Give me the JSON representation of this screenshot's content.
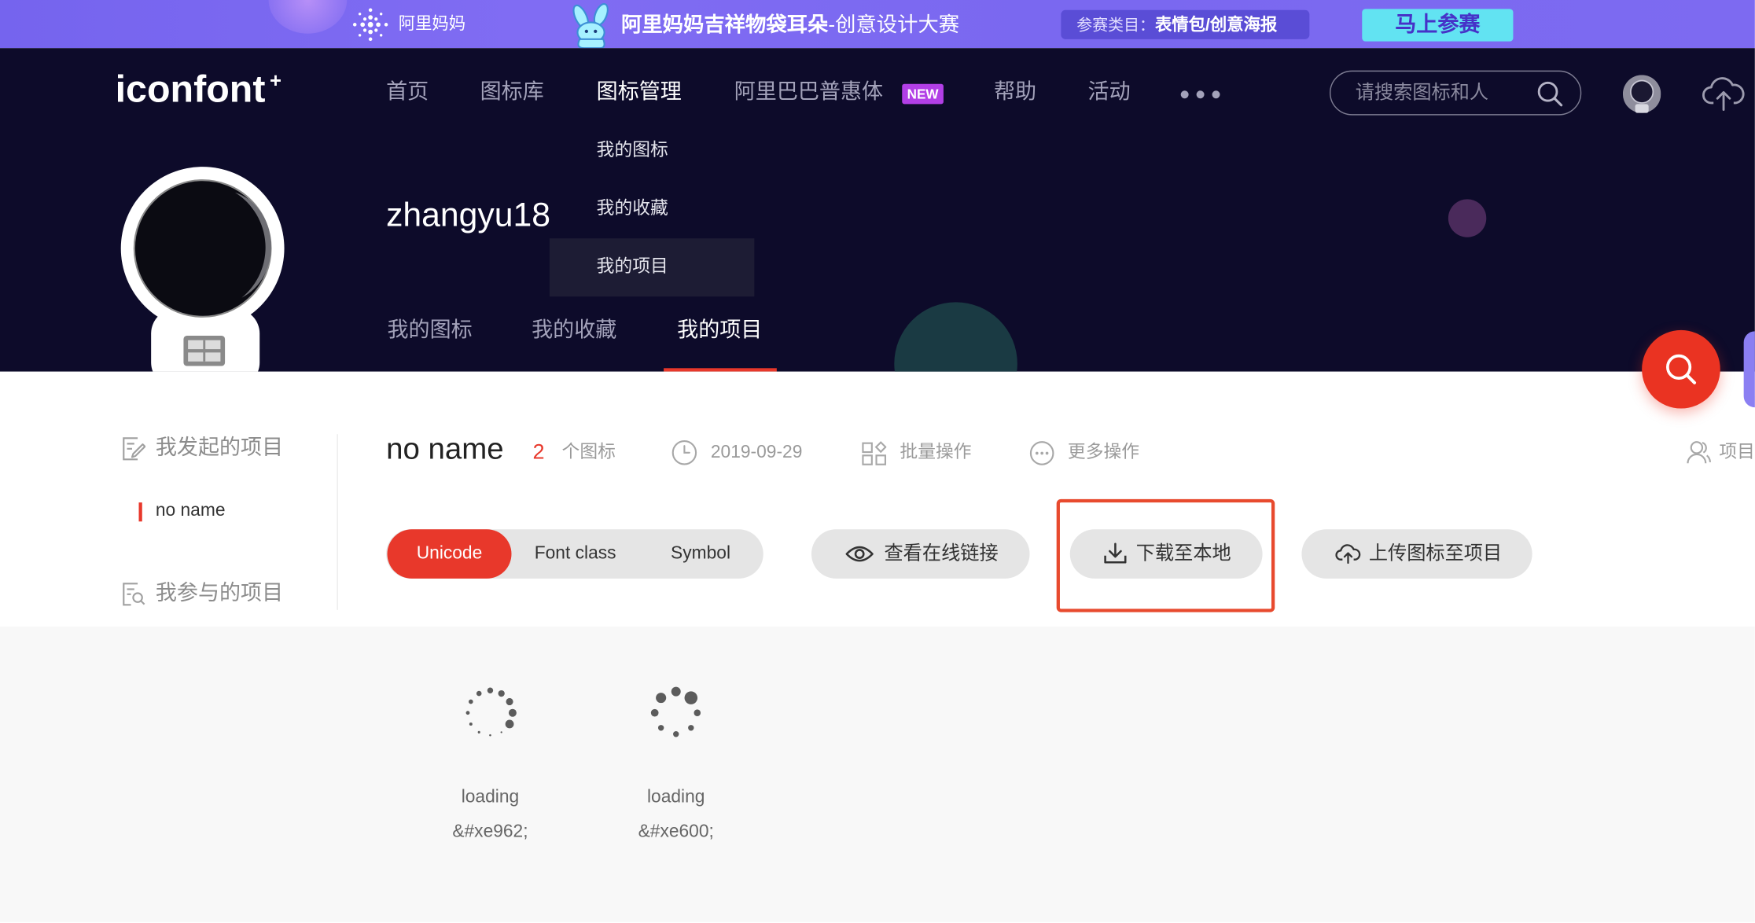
{
  "banner": {
    "brand_name": "阿里妈妈",
    "brand_icon": "alimama-logo-icon",
    "mascot_icon": "kangaroo-mascot-icon",
    "title_bold": "阿里妈妈吉祥物袋耳朵",
    "title_rest": "-创意设计大赛",
    "category_label": "参赛类目：",
    "category_value": "表情包/创意海报",
    "cta_label": "马上参赛",
    "background_color": "#7b68ee",
    "cta_color": "#62e3f2"
  },
  "header": {
    "logo_text": "iconfont",
    "logo_plus": "+",
    "nav": [
      {
        "label": "首页"
      },
      {
        "label": "图标库"
      },
      {
        "label": "图标管理",
        "active": true
      },
      {
        "label": "阿里巴巴普惠体",
        "badge": "NEW"
      },
      {
        "label": "帮助"
      },
      {
        "label": "活动"
      }
    ],
    "more_icon": "ellipsis-icon",
    "search": {
      "placeholder": "请搜索图标和人",
      "icon": "search-icon"
    },
    "user_icon": "avatar-icon",
    "upload_icon": "cloud-upload-icon",
    "background_color": "#0d0b2a"
  },
  "nav_dropdown": {
    "items": [
      {
        "label": "我的图标"
      },
      {
        "label": "我的收藏"
      },
      {
        "label": "我的项目",
        "active": true
      }
    ]
  },
  "profile": {
    "username": "zhangyu18",
    "avatar_icon": "astronaut-avatar-icon",
    "tabs": [
      {
        "label": "我的图标"
      },
      {
        "label": "我的收藏"
      },
      {
        "label": "我的项目",
        "active": true
      }
    ]
  },
  "floating_search": {
    "icon": "search-icon",
    "color": "#ea3322"
  },
  "sidebar": {
    "created_heading": "我发起的项目",
    "created_icon": "document-edit-icon",
    "created_items": [
      {
        "label": "no name",
        "active": true
      }
    ],
    "joined_heading": "我参与的项目",
    "joined_icon": "document-search-icon"
  },
  "project": {
    "name": "no name",
    "icon_count": "2",
    "icon_count_unit": "个图标",
    "date": "2019-09-29",
    "date_icon": "clock-icon",
    "batch_label": "批量操作",
    "batch_icon": "batch-grid-icon",
    "more_label": "更多操作",
    "more_icon": "more-circle-icon",
    "members_label": "项目",
    "members_icon": "members-icon"
  },
  "toolbar": {
    "formats": [
      {
        "label": "Unicode",
        "active": true
      },
      {
        "label": "Font class"
      },
      {
        "label": "Symbol"
      }
    ],
    "view_link_label": "查看在线链接",
    "view_link_icon": "eye-icon",
    "download_label": "下载至本地",
    "download_icon": "download-icon",
    "upload_label": "上传图标至项目",
    "upload_icon": "cloud-upload-icon",
    "highlight_color": "#e84a2e"
  },
  "icons": [
    {
      "name": "loading",
      "code": "&#xe962;",
      "glyph": "loading-spinner-icon"
    },
    {
      "name": "loading",
      "code": "&#xe600;",
      "glyph": "loading-spinner-icon"
    }
  ],
  "accent_color": "#e8382b"
}
